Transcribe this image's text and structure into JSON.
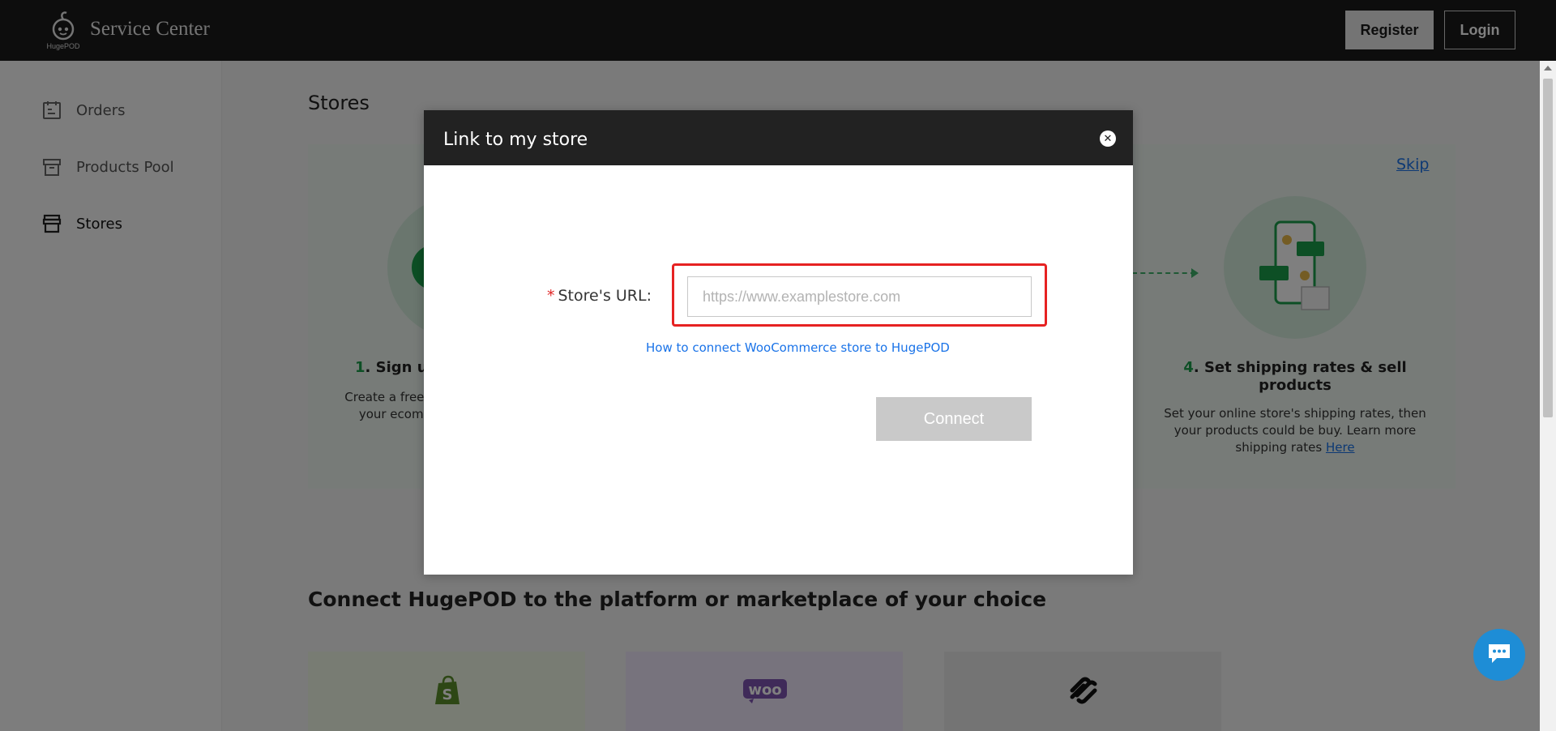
{
  "header": {
    "logo_text": "HugePOD",
    "brand": "Service Center",
    "register_label": "Register",
    "login_label": "Login"
  },
  "sidebar": {
    "items": [
      {
        "label": "Orders",
        "icon": "orders-icon"
      },
      {
        "label": "Products Pool",
        "icon": "box-icon"
      },
      {
        "label": "Stores",
        "icon": "store-icon",
        "active": true
      }
    ]
  },
  "main": {
    "title": "Stores",
    "skip_label": "Skip",
    "step1": {
      "number": "1",
      "title": ". Sign up",
      "text": "Create a free link your ecomm"
    },
    "step4": {
      "number": "4",
      "title": ". Set shipping rates & sell products",
      "text": "Set your online store's shipping rates, then your products could be buy. Learn more shipping rates",
      "link": "Here"
    },
    "connect_title": "Connect HugePOD to the platform or marketplace of your choice",
    "platforms": [
      {
        "name": "Shopify",
        "icon": "shopify-icon"
      },
      {
        "name": "WooCommerce",
        "icon": "woo-icon"
      },
      {
        "name": "Squarespace",
        "icon": "squarespace-icon"
      }
    ]
  },
  "modal": {
    "title": "Link to my store",
    "close_icon": "close-icon",
    "field_required": "*",
    "field_label": "Store's URL:",
    "url_value": "",
    "url_placeholder": "https://www.examplestore.com",
    "howto_link": "How to connect WooCommerce store to HugePOD",
    "connect_label": "Connect"
  },
  "colors": {
    "header_bg": "#1b1b1b",
    "accent_green": "#1a9e4a",
    "link_blue": "#1a73e8",
    "highlight_red": "#e62222",
    "chat_blue": "#1e8dd6"
  }
}
